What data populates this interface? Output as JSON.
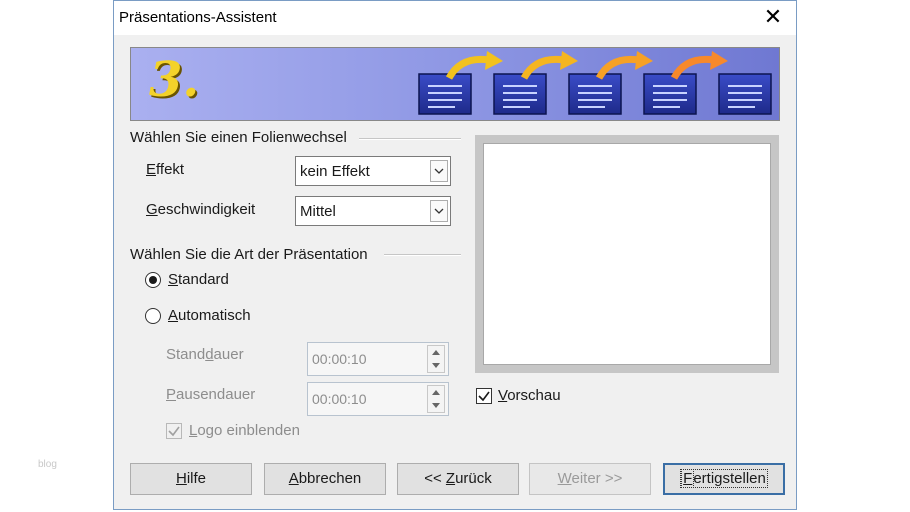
{
  "watermark": "blog",
  "window": {
    "title": "Präsentations-Assistent",
    "close_glyph": "✕"
  },
  "banner": {
    "step": "3.",
    "step_color": "#f3d22a",
    "gradient": [
      "#aab0f0",
      "#6f78d2"
    ]
  },
  "transition_group": {
    "title": "Wählen Sie einen Folienwechsel",
    "effect": {
      "label_mnemonic": "E",
      "label_rest": "ffekt",
      "value": "kein Effekt"
    },
    "speed": {
      "label_mnemonic": "G",
      "label_rest": "eschwindigkeit",
      "value": "Mittel"
    }
  },
  "type_group": {
    "title": "Wählen Sie die Art der Präsentation",
    "standard": {
      "mnemonic": "S",
      "rest": "tandard",
      "selected": true
    },
    "automatic": {
      "mnemonic": "A",
      "rest": "utomatisch",
      "selected": false
    },
    "duration": {
      "pre": "Stand",
      "mnemonic": "d",
      "post": "auer",
      "value": "00:00:10",
      "enabled": false
    },
    "pause": {
      "mnemonic": "P",
      "rest": "ausendauer",
      "value": "00:00:10",
      "enabled": false
    },
    "logo": {
      "mnemonic": "L",
      "rest": "ogo einblenden",
      "checked": true,
      "enabled": false
    }
  },
  "preview": {
    "mnemonic": "V",
    "rest": "orschau",
    "checked": true
  },
  "buttons": {
    "help": {
      "mnemonic": "H",
      "rest": "ilfe"
    },
    "cancel": {
      "mnemonic": "A",
      "rest": "bbrechen"
    },
    "back": {
      "prefix": "<< ",
      "mnemonic": "Z",
      "rest": "urück"
    },
    "next": {
      "mnemonic": "W",
      "rest": "eiter >>",
      "enabled": false
    },
    "finish": {
      "mnemonic": "F",
      "rest": "ertigstellen",
      "default": true
    }
  }
}
